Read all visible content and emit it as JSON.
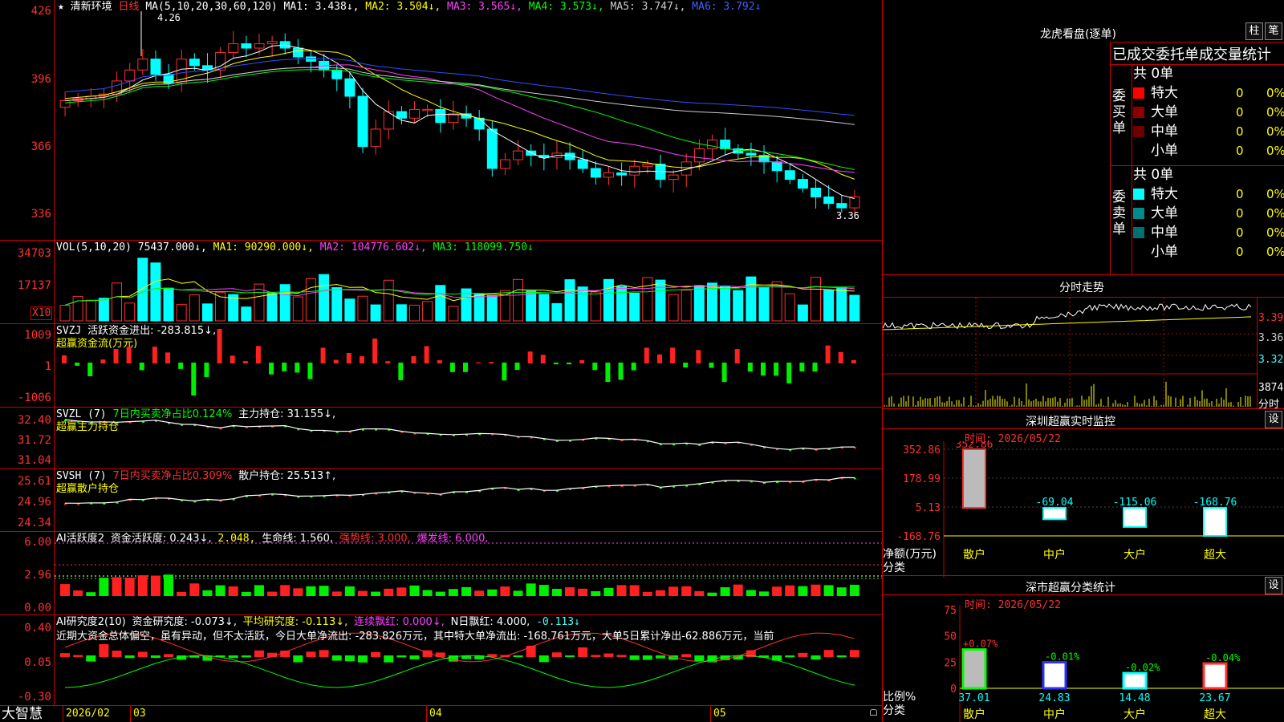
{
  "main_chart": {
    "star": "★",
    "stock_name": "清新环境",
    "period": "日线",
    "ma_label": "MA(5,10,20,30,60,120)",
    "ma1": "MA1: 3.438↓,",
    "ma2": "MA2: 3.504↓,",
    "ma3": "MA3: 3.565↓,",
    "ma4": "MA4: 3.573↓,",
    "ma5": "MA5: 3.747↓,",
    "ma6": "MA6: 3.792↓",
    "high_label": "4.26",
    "low_label": "3.36",
    "ticks": [
      "426",
      "396",
      "366",
      "336"
    ]
  },
  "vol_panel": {
    "label": "VOL(5,10,20)",
    "vol": "75437.000↓,",
    "ma1": "MA1: 90290.000↓,",
    "ma2": "MA2: 104776.602↓,",
    "ma3": "MA3: 118099.750↓",
    "ticks": [
      "34703",
      "17137"
    ],
    "unit": "X10"
  },
  "svzj_panel": {
    "label": "SVZJ",
    "flow": "活跃资金进出: -283.815↓,",
    "title": "超赢资金流(万元)",
    "ticks": [
      "1009",
      "1",
      "-1006"
    ]
  },
  "svzl_panel": {
    "label": "SVZL (7)",
    "ratio": "7日内买卖净占比0.124%",
    "hold": "主力持仓: 31.155↓,",
    "title": "超赢主力持仓",
    "ticks": [
      "32.40",
      "31.72",
      "31.04"
    ]
  },
  "svsh_panel": {
    "label": "SVSH (7)",
    "ratio": "7日内买卖净占比0.309%",
    "hold": "散户持仓: 25.513↑,",
    "title": "超赢散户持仓",
    "ticks": [
      "25.61",
      "24.96",
      "24.34"
    ]
  },
  "ai_active_panel": {
    "label": "AI活跃度2",
    "activity": "资金活跃度: 0.243↓,",
    "v2": "2.048,",
    "life": "生命线: 1.560,",
    "strong": "强势线: 3.000,",
    "burst": "爆发线: 6.000,",
    "ticks": [
      "6.00",
      "2.96",
      "0.00"
    ]
  },
  "ai_research_panel": {
    "label": "AI研究度2(10)",
    "research": "资金研究度: -0.073↓,",
    "avg": "平均研究度: -0.113↓,",
    "consecutive": "连续飘红: 0.000↓,",
    "nday": "N日飘红: 4.000,",
    "last": "-0.113↓",
    "comment": "近期大资金总体偏空，虽有异动，但不太活跃，今日大单净流出: -283.826万元，其中特大单净流出: -168.761万元，大单5日累计净出-62.886万元，当前",
    "ticks": [
      "0.40",
      "0.05",
      "-0.30"
    ]
  },
  "bottom_bar": {
    "brand": "大智慧",
    "dates": [
      "2026/02",
      "03",
      "04",
      "05"
    ]
  },
  "dragon": {
    "title": "龙虎看盘(逐单)",
    "btn1": "柱",
    "btn2": "笔",
    "subtitle": "已成交委托单成交量统计",
    "buy_label": "委买单",
    "buy_total": "共 0单",
    "sell_label": "委卖单",
    "sell_total": "共 0单",
    "buy_rows": [
      {
        "name": "特大",
        "count": "0",
        "pct": "0%",
        "color": "#ff0000"
      },
      {
        "name": "大单",
        "count": "0",
        "pct": "0%",
        "color": "#8b0000"
      },
      {
        "name": "中单",
        "count": "0",
        "pct": "0%",
        "color": "#6a0000"
      },
      {
        "name": "小单",
        "count": "0",
        "pct": "0%",
        "color": ""
      }
    ],
    "sell_rows": [
      {
        "name": "特大",
        "count": "0",
        "pct": "0%",
        "color": "#00ffff"
      },
      {
        "name": "大单",
        "count": "0",
        "pct": "0%",
        "color": "#008b8b"
      },
      {
        "name": "中单",
        "count": "0",
        "pct": "0%",
        "color": "#007070"
      },
      {
        "name": "小单",
        "count": "0",
        "pct": "0%",
        "color": ""
      }
    ]
  },
  "intraday": {
    "title": "分时走势",
    "ticks": [
      "3.395",
      "3.360",
      "3.325",
      "3874"
    ],
    "unit": "分时"
  },
  "realtime": {
    "title": "深圳超赢实时监控",
    "btn": "设",
    "time": "时间: 2026/05/22",
    "ticks": [
      "352.86",
      "178.99",
      "5.13",
      "-168.76"
    ],
    "ylabel": "净额(万元)",
    "xlabel": "分类",
    "cats": [
      "散户",
      "中户",
      "大户",
      "超大"
    ],
    "values": [
      "352.86",
      "-69.04",
      "-115.06",
      "-168.76"
    ]
  },
  "classify": {
    "title": "深市超赢分类统计",
    "btn": "设",
    "time": "时间: 2026/05/22",
    "ticks": [
      "75",
      "50",
      "25",
      "0"
    ],
    "ylabel": "比例%",
    "xlabel": "分类",
    "cats": [
      "散户",
      "中户",
      "大户",
      "超大"
    ],
    "pcts": [
      "+0.07%",
      "-0.01%",
      "-0.02%",
      "-0.04%"
    ],
    "vals": [
      "37.01",
      "24.83",
      "14.48",
      "23.67"
    ]
  },
  "chart_data": {
    "type": "bar",
    "categories": [
      "散户",
      "中户",
      "大户",
      "超大"
    ],
    "values": [
      352.86,
      -69.04,
      -115.06,
      -168.76
    ],
    "title": "深圳超赢实时监控",
    "ylabel": "净额(万元)",
    "xlabel": "分类",
    "ylim": [
      -168.76,
      352.86
    ]
  }
}
